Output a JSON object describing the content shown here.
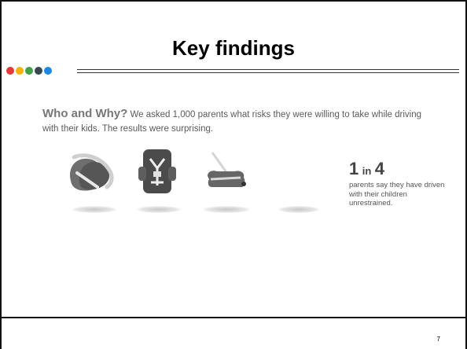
{
  "slide": {
    "title": "Key findings",
    "page_number": "7",
    "accent_dots": [
      {
        "color": "#e53935",
        "icon": "dot-red"
      },
      {
        "color": "#f6b400",
        "icon": "dot-yellow"
      },
      {
        "color": "#43a047",
        "icon": "dot-green"
      },
      {
        "color": "#37474f",
        "icon": "dot-dark"
      },
      {
        "color": "#1e88e5",
        "icon": "dot-blue"
      }
    ],
    "intro": {
      "lead": "Who and Why?",
      "text": " We asked 1,000 parents what risks they were willing to take while driving with their kids. The results were surprising."
    },
    "icons": [
      "infant-carrier-icon",
      "harness-car-seat-icon",
      "booster-seat-icon",
      "no-seat-icon"
    ],
    "stat": {
      "big": "1",
      "in_word": "in",
      "big2": "4",
      "description": "parents say they have driven with their children unrestrained."
    }
  }
}
